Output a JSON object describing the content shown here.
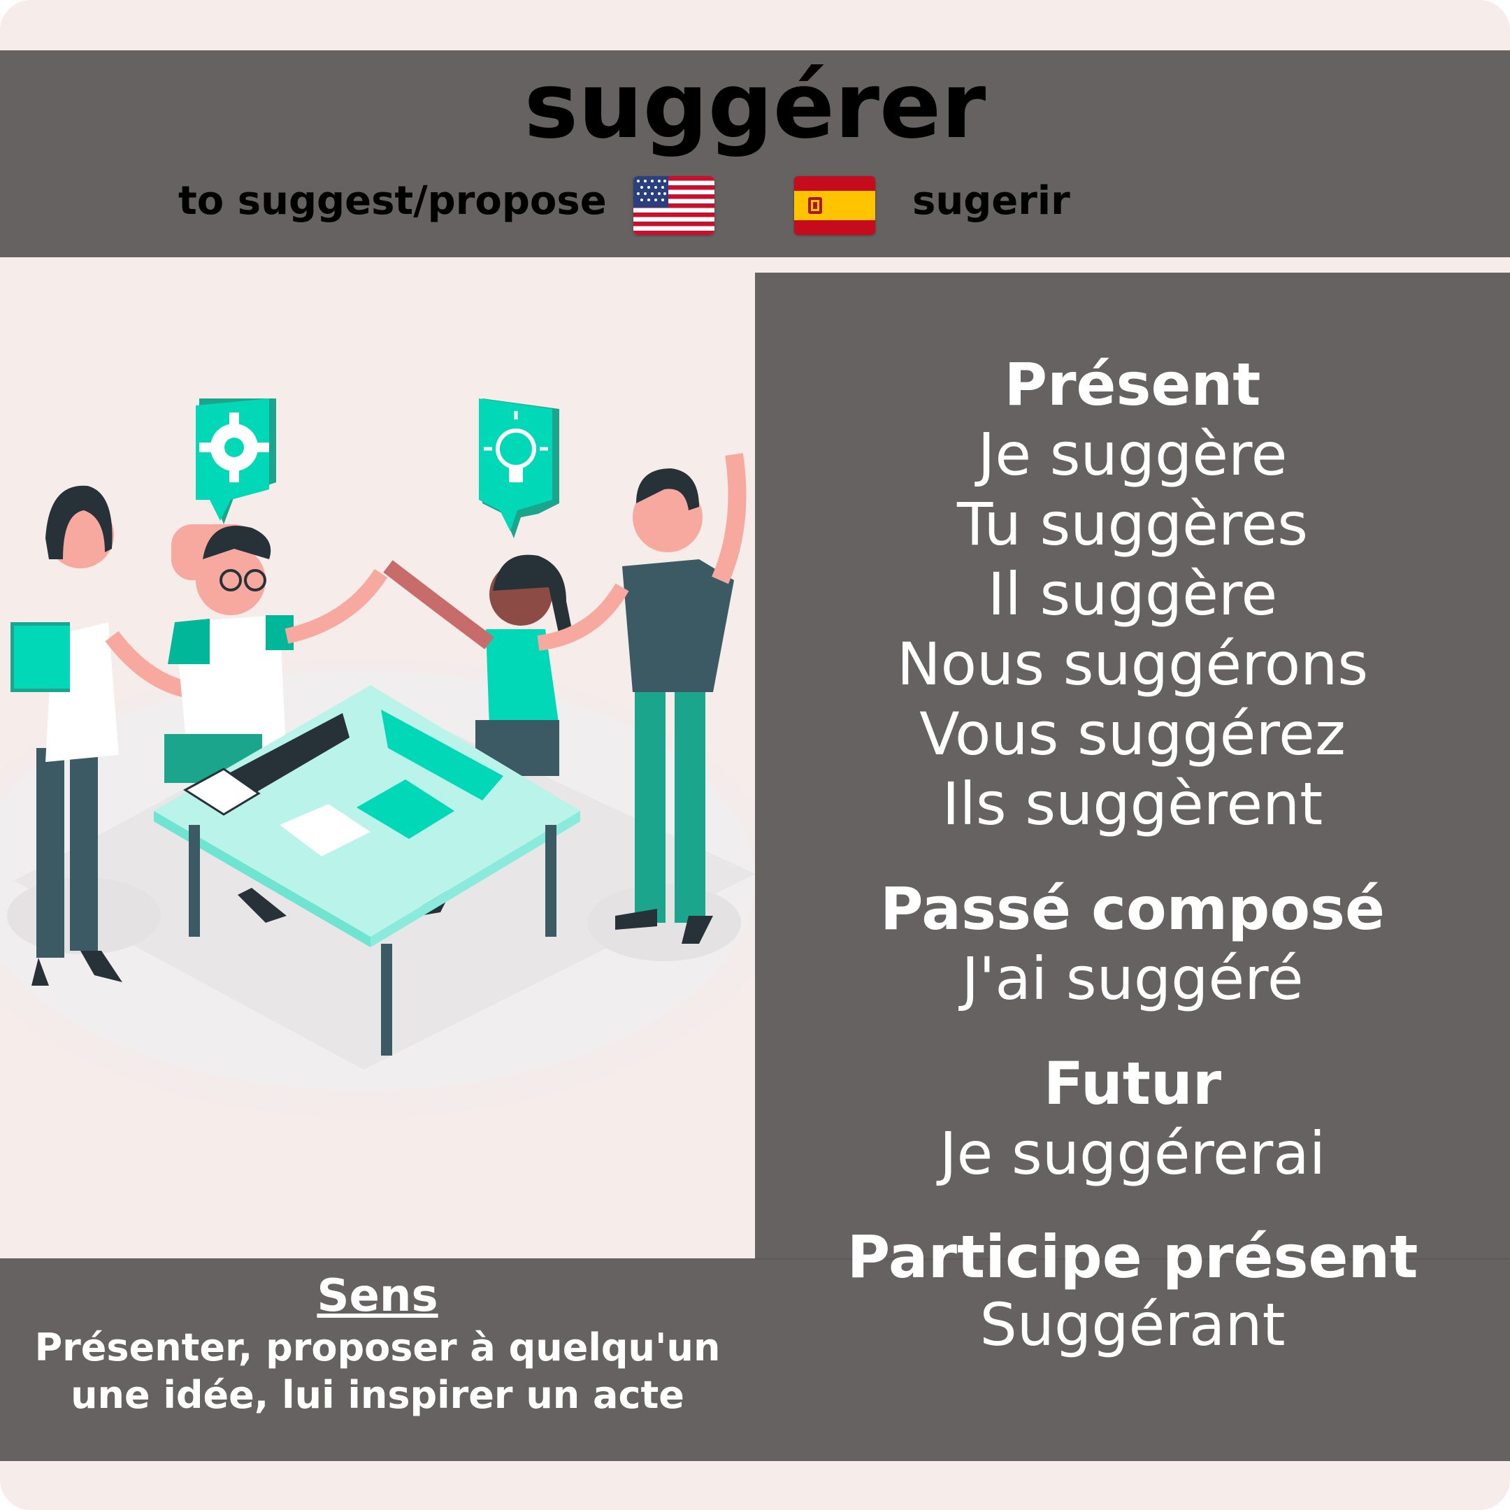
{
  "verb": "suggérer",
  "translation_en": "to suggest/propose",
  "translation_es": "sugerir",
  "flags": {
    "en": "us-flag-icon",
    "es": "spain-flag-icon"
  },
  "colors": {
    "panel": "#666261",
    "background": "#f6ece9",
    "accent": "#00d8b8",
    "accent_dark": "#1aa58c",
    "text": "#ffffff"
  },
  "conjugation": {
    "present_label": "Présent",
    "present": [
      "Je suggère",
      "Tu suggères",
      "Il suggère",
      "Nous suggérons",
      "Vous suggérez",
      "Ils suggèrent"
    ],
    "passe_compose_label": "Passé composé",
    "passe_compose": "J'ai suggéré",
    "futur_label": "Futur",
    "futur": "Je suggérerai",
    "participe_present_label": "Participe présent",
    "participe_present": "Suggérant"
  },
  "sens": {
    "title": "Sens",
    "line1": "Présenter, proposer à quelqu'un",
    "line2": "une idée, lui inspirer un acte"
  },
  "illustration": "team-meeting-illustration"
}
